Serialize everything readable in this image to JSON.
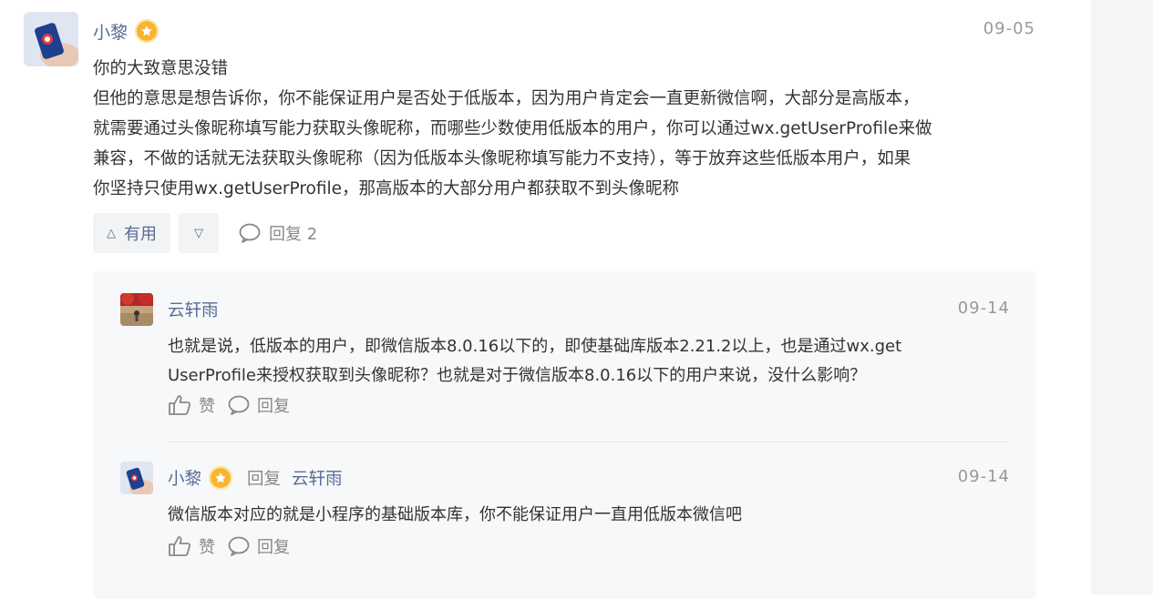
{
  "post": {
    "author": "小黎",
    "date": "09-05",
    "lines": [
      "你的大致意思没错",
      "但他的意思是想告诉你，你不能保证用户是否处于低版本，因为用户肯定会一直更新微信啊，大部分是高版本，",
      "就需要通过头像昵称填写能力获取头像昵称，而哪些少数使用低版本的用户，你可以通过wx.getUserProfile来做",
      "兼容，不做的话就无法获取头像昵称（因为低版本头像昵称填写能力不支持），等于放弃这些低版本用户，如果",
      "你坚持只使用wx.getUserProfile，那高版本的大部分用户都获取不到头像昵称"
    ],
    "useful_label": "有用",
    "useful_icon": "triangle-up-icon",
    "down_icon": "triangle-down-icon",
    "reply_label": "回复 2"
  },
  "replies": [
    {
      "author": "云轩雨",
      "date": "09-14",
      "lines": [
        "也就是说，低版本的用户，即微信版本8.0.16以下的，即使基础库版本2.21.2以上，也是通过wx.get",
        "UserProfile来授权获取到头像昵称？也就是对于微信版本8.0.16以下的用户来说，没什么影响？"
      ],
      "like_label": "赞",
      "reply_label": "回复"
    },
    {
      "author": "小黎",
      "reply_word": "回复",
      "reply_to": "云轩雨",
      "date": "09-14",
      "lines": [
        "微信版本对应的就是小程序的基础版本库，你不能保证用户一直用低版本微信吧"
      ],
      "like_label": "赞",
      "reply_label": "回复"
    }
  ],
  "colors": {
    "link": "#576b95",
    "muted": "#999999",
    "badge": "#f7b531",
    "panel": "#f7f8fa"
  }
}
